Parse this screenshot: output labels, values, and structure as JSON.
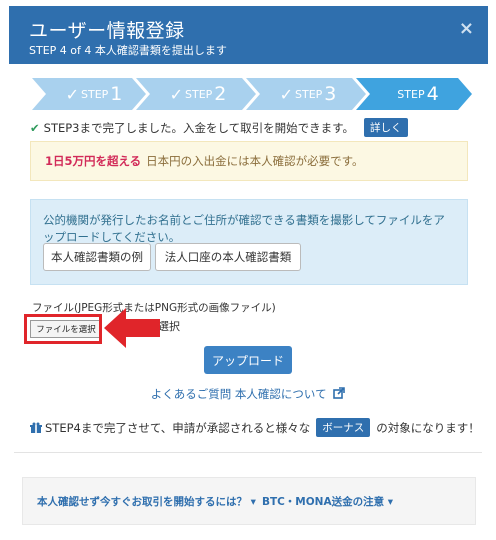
{
  "header": {
    "title": "ユーザー情報登録",
    "subtitle": "STEP 4 of 4 本人確認書類を提出します",
    "close_symbol": "×"
  },
  "steps": [
    {
      "prefix": "STEP",
      "num": "1",
      "done": true
    },
    {
      "prefix": "STEP",
      "num": "2",
      "done": true
    },
    {
      "prefix": "STEP",
      "num": "3",
      "done": true
    },
    {
      "prefix": "STEP",
      "num": "4",
      "done": false,
      "active": true
    }
  ],
  "step_check_symbol": "✓",
  "notice": {
    "check_symbol": "✔",
    "text": "STEP3まで完了しました。入金をして取引を開始できます。",
    "details_label": "詳しく"
  },
  "warning": {
    "highlight": "1日5万円を超える",
    "text": "日本円の入出金には本人確認が必要です。"
  },
  "info": {
    "description": "公的機関が発行したお名前とご住所が確認できる書類を撮影してファイルをアップロードしてください。",
    "example_button": "本人確認書類の例",
    "corporate_button": "法人口座の本人確認書類"
  },
  "file": {
    "label": "ファイル(JPEG形式またはPNG形式の画像ファイル)",
    "choose_button": "ファイルを選択",
    "status": "選択"
  },
  "upload_button": "アップロード",
  "faq_link": "よくあるご質問 本人確認について",
  "bonus": {
    "text_before": "STEP4まで完了させて、申請が承認されると様々な",
    "badge": "ボーナス",
    "text_after": "の対象になります！"
  },
  "footer": {
    "link1": "本人確認せず今すぐお取引を開始するには？ ▾",
    "link2": "BTC・MONA送金の注意 ▾"
  },
  "colors": {
    "header": "#2f6fae",
    "step_done": "#a9d1ee",
    "step_active": "#3fa3df",
    "arrow": "#e0252a"
  }
}
